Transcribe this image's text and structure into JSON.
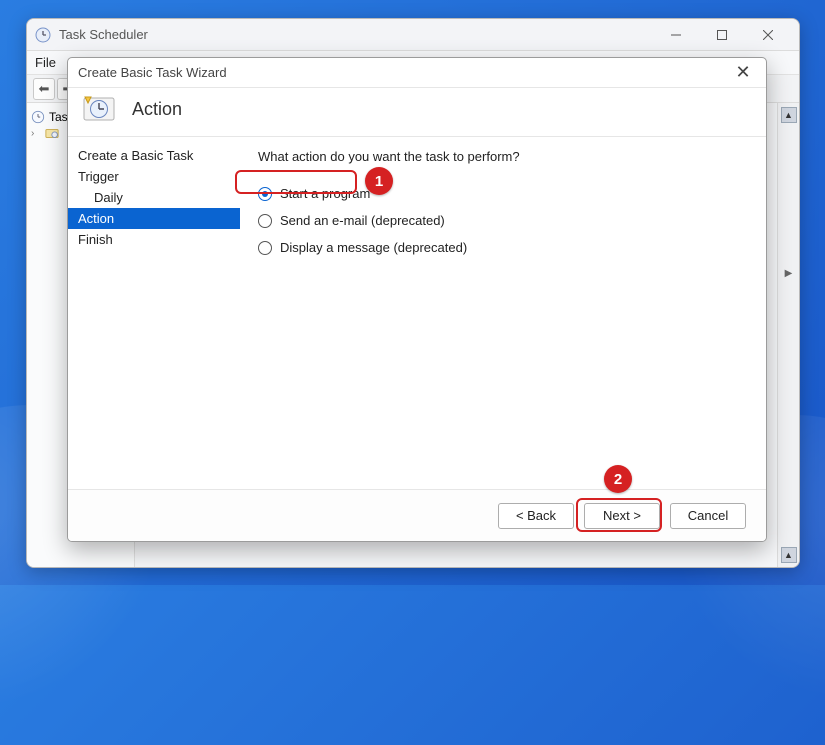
{
  "parent": {
    "title": "Task Scheduler",
    "menu": {
      "file": "File"
    },
    "tree": {
      "root": "Task",
      "expand_glyph": "›"
    }
  },
  "dialog": {
    "title": "Create Basic Task Wizard",
    "header": "Action",
    "nav": {
      "create": "Create a Basic Task",
      "trigger": "Trigger",
      "daily": "Daily",
      "action": "Action",
      "finish": "Finish"
    },
    "prompt": "What action do you want the task to perform?",
    "options": {
      "start_program": "Start a program",
      "send_email": "Send an e-mail (deprecated)",
      "display_message": "Display a message (deprecated)"
    },
    "buttons": {
      "back": "< Back",
      "next": "Next >",
      "cancel": "Cancel"
    }
  },
  "annotations": {
    "badge1": "1",
    "badge2": "2"
  }
}
